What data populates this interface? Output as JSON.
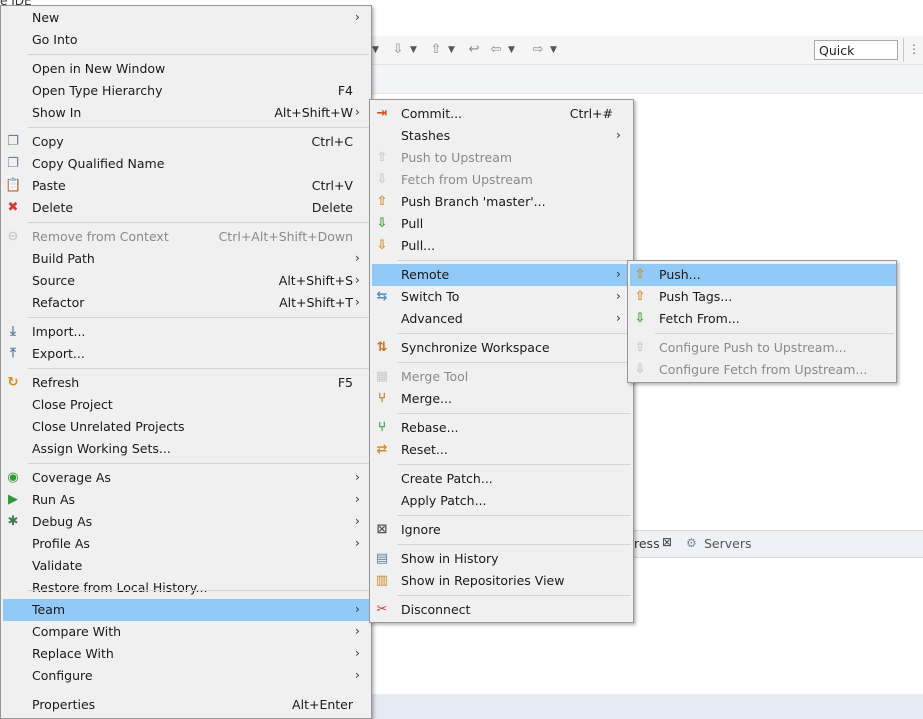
{
  "ide": {
    "title_fragment": "e IDE",
    "quick_access": "Quick Access",
    "bottom_tabs": {
      "progress": "ress",
      "servers": "Servers"
    }
  },
  "colors": {
    "selection": "#91c9f7",
    "menu_bg": "#f0f0f0",
    "disabled_text": "#8a8a8a"
  },
  "context_menu": {
    "items": [
      {
        "label": "New",
        "shortcut": "",
        "submenu": true,
        "icon": "",
        "disabled": false
      },
      {
        "label": "Go Into",
        "shortcut": "",
        "submenu": false,
        "icon": "",
        "disabled": false
      },
      {
        "label": "Open in New Window",
        "shortcut": "",
        "submenu": false,
        "icon": "",
        "disabled": false
      },
      {
        "label": "Open Type Hierarchy",
        "shortcut": "F4",
        "submenu": false,
        "icon": "",
        "disabled": false
      },
      {
        "label": "Show In",
        "shortcut": "Alt+Shift+W",
        "submenu": true,
        "icon": "",
        "disabled": false
      },
      {
        "label": "Copy",
        "shortcut": "Ctrl+C",
        "submenu": false,
        "icon": "copy-icon",
        "disabled": false
      },
      {
        "label": "Copy Qualified Name",
        "shortcut": "",
        "submenu": false,
        "icon": "copy-qualified-icon",
        "disabled": false
      },
      {
        "label": "Paste",
        "shortcut": "Ctrl+V",
        "submenu": false,
        "icon": "paste-icon",
        "disabled": false
      },
      {
        "label": "Delete",
        "shortcut": "Delete",
        "submenu": false,
        "icon": "delete-icon",
        "disabled": false
      },
      {
        "label": "Remove from Context",
        "shortcut": "Ctrl+Alt+Shift+Down",
        "submenu": false,
        "icon": "remove-context-icon",
        "disabled": true
      },
      {
        "label": "Build Path",
        "shortcut": "",
        "submenu": true,
        "icon": "",
        "disabled": false
      },
      {
        "label": "Source",
        "shortcut": "Alt+Shift+S",
        "submenu": true,
        "icon": "",
        "disabled": false
      },
      {
        "label": "Refactor",
        "shortcut": "Alt+Shift+T",
        "submenu": true,
        "icon": "",
        "disabled": false
      },
      {
        "label": "Import...",
        "shortcut": "",
        "submenu": false,
        "icon": "import-icon",
        "disabled": false
      },
      {
        "label": "Export...",
        "shortcut": "",
        "submenu": false,
        "icon": "export-icon",
        "disabled": false
      },
      {
        "label": "Refresh",
        "shortcut": "F5",
        "submenu": false,
        "icon": "refresh-icon",
        "disabled": false
      },
      {
        "label": "Close Project",
        "shortcut": "",
        "submenu": false,
        "icon": "",
        "disabled": false
      },
      {
        "label": "Close Unrelated Projects",
        "shortcut": "",
        "submenu": false,
        "icon": "",
        "disabled": false
      },
      {
        "label": "Assign Working Sets...",
        "shortcut": "",
        "submenu": false,
        "icon": "",
        "disabled": false
      },
      {
        "label": "Coverage As",
        "shortcut": "",
        "submenu": true,
        "icon": "coverage-icon",
        "disabled": false
      },
      {
        "label": "Run As",
        "shortcut": "",
        "submenu": true,
        "icon": "run-icon",
        "disabled": false
      },
      {
        "label": "Debug As",
        "shortcut": "",
        "submenu": true,
        "icon": "debug-icon",
        "disabled": false
      },
      {
        "label": "Profile As",
        "shortcut": "",
        "submenu": true,
        "icon": "",
        "disabled": false
      },
      {
        "label": "Validate",
        "shortcut": "",
        "submenu": false,
        "icon": "",
        "disabled": false
      },
      {
        "label": "Restore from Local History...",
        "shortcut": "",
        "submenu": false,
        "icon": "",
        "disabled": false
      },
      {
        "label": "Team",
        "shortcut": "",
        "submenu": true,
        "icon": "",
        "disabled": false,
        "selected": true
      },
      {
        "label": "Compare With",
        "shortcut": "",
        "submenu": true,
        "icon": "",
        "disabled": false
      },
      {
        "label": "Replace With",
        "shortcut": "",
        "submenu": true,
        "icon": "",
        "disabled": false
      },
      {
        "label": "Configure",
        "shortcut": "",
        "submenu": true,
        "icon": "",
        "disabled": false
      },
      {
        "label": "Properties",
        "shortcut": "Alt+Enter",
        "submenu": false,
        "icon": "",
        "disabled": false
      }
    ]
  },
  "team_menu": {
    "items": [
      {
        "label": "Commit...",
        "shortcut": "Ctrl+#",
        "submenu": false,
        "icon": "commit-icon",
        "disabled": false
      },
      {
        "label": "Stashes",
        "shortcut": "",
        "submenu": true,
        "icon": "",
        "disabled": false
      },
      {
        "label": "Push to Upstream",
        "shortcut": "",
        "submenu": false,
        "icon": "push-upstream-icon",
        "disabled": true
      },
      {
        "label": "Fetch from Upstream",
        "shortcut": "",
        "submenu": false,
        "icon": "fetch-upstream-icon",
        "disabled": true
      },
      {
        "label": "Push Branch 'master'...",
        "shortcut": "",
        "submenu": false,
        "icon": "push-branch-icon",
        "disabled": false
      },
      {
        "label": "Pull",
        "shortcut": "",
        "submenu": false,
        "icon": "pull-icon",
        "disabled": false
      },
      {
        "label": "Pull...",
        "shortcut": "",
        "submenu": false,
        "icon": "pull-dialog-icon",
        "disabled": false
      },
      {
        "label": "Remote",
        "shortcut": "",
        "submenu": true,
        "icon": "",
        "disabled": false,
        "selected": true
      },
      {
        "label": "Switch To",
        "shortcut": "",
        "submenu": true,
        "icon": "switch-branch-icon",
        "disabled": false
      },
      {
        "label": "Advanced",
        "shortcut": "",
        "submenu": true,
        "icon": "",
        "disabled": false
      },
      {
        "label": "Synchronize Workspace",
        "shortcut": "",
        "submenu": false,
        "icon": "synchronize-icon",
        "disabled": false
      },
      {
        "label": "Merge Tool",
        "shortcut": "",
        "submenu": false,
        "icon": "merge-tool-icon",
        "disabled": true
      },
      {
        "label": "Merge...",
        "shortcut": "",
        "submenu": false,
        "icon": "merge-icon",
        "disabled": false
      },
      {
        "label": "Rebase...",
        "shortcut": "",
        "submenu": false,
        "icon": "rebase-icon",
        "disabled": false
      },
      {
        "label": "Reset...",
        "shortcut": "",
        "submenu": false,
        "icon": "reset-icon",
        "disabled": false
      },
      {
        "label": "Create Patch...",
        "shortcut": "",
        "submenu": false,
        "icon": "",
        "disabled": false
      },
      {
        "label": "Apply Patch...",
        "shortcut": "",
        "submenu": false,
        "icon": "",
        "disabled": false
      },
      {
        "label": "Ignore",
        "shortcut": "",
        "submenu": false,
        "icon": "ignore-icon",
        "disabled": false
      },
      {
        "label": "Show in History",
        "shortcut": "",
        "submenu": false,
        "icon": "history-icon",
        "disabled": false
      },
      {
        "label": "Show in Repositories View",
        "shortcut": "",
        "submenu": false,
        "icon": "repositories-icon",
        "disabled": false
      },
      {
        "label": "Disconnect",
        "shortcut": "",
        "submenu": false,
        "icon": "disconnect-icon",
        "disabled": false
      }
    ]
  },
  "remote_menu": {
    "items": [
      {
        "label": "Push...",
        "shortcut": "",
        "submenu": false,
        "icon": "push-icon",
        "disabled": false,
        "selected": true
      },
      {
        "label": "Push Tags...",
        "shortcut": "",
        "submenu": false,
        "icon": "push-tags-icon",
        "disabled": false
      },
      {
        "label": "Fetch From...",
        "shortcut": "",
        "submenu": false,
        "icon": "fetch-icon",
        "disabled": false
      },
      {
        "label": "Configure Push to Upstream...",
        "shortcut": "",
        "submenu": false,
        "icon": "configure-push-icon",
        "disabled": true
      },
      {
        "label": "Configure Fetch from Upstream...",
        "shortcut": "",
        "submenu": false,
        "icon": "configure-fetch-icon",
        "disabled": true
      }
    ]
  }
}
